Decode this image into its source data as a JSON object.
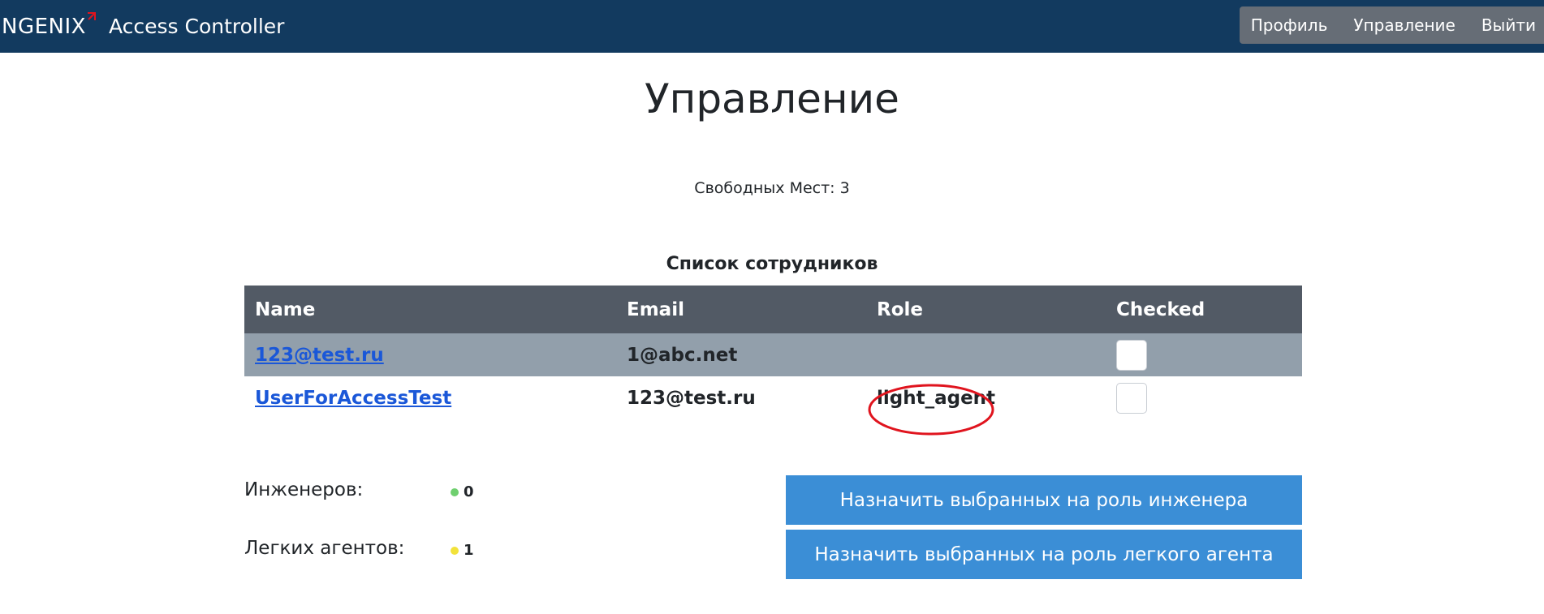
{
  "header": {
    "logo_text": "NGENIX",
    "app_title": "Access Controller",
    "nav": [
      "Профиль",
      "Управление",
      "Выйти"
    ]
  },
  "page": {
    "title": "Управление",
    "free_seats": "Свободных Мест: 3",
    "list_title": "Список сотрудников"
  },
  "table": {
    "columns": [
      "Name",
      "Email",
      "Role",
      "Checked"
    ],
    "rows": [
      {
        "name": "123@test.ru",
        "email": "1@abc.net",
        "role": "",
        "checked": false
      },
      {
        "name": "UserForAccessTest",
        "email": "123@test.ru",
        "role": "light_agent",
        "checked": false
      }
    ]
  },
  "stats": {
    "engineers_label": "Инженеров:",
    "engineers_count": "0",
    "light_agents_label": "Легких агентов:",
    "light_agents_count": "1"
  },
  "actions": {
    "assign_engineer": "Назначить выбранных на роль инженера",
    "assign_light_agent": "Назначить выбранных на роль легкого агента"
  },
  "colors": {
    "header_bg": "#123a5f",
    "nav_bg": "#666d76",
    "table_header_bg": "#525a65",
    "selected_row_bg": "#929fab",
    "link": "#1a57d8",
    "button_bg": "#3b8ed6",
    "engineer_dot": "#6fcf6f",
    "light_agent_dot": "#f2e23a",
    "highlight": "#e0141e"
  }
}
